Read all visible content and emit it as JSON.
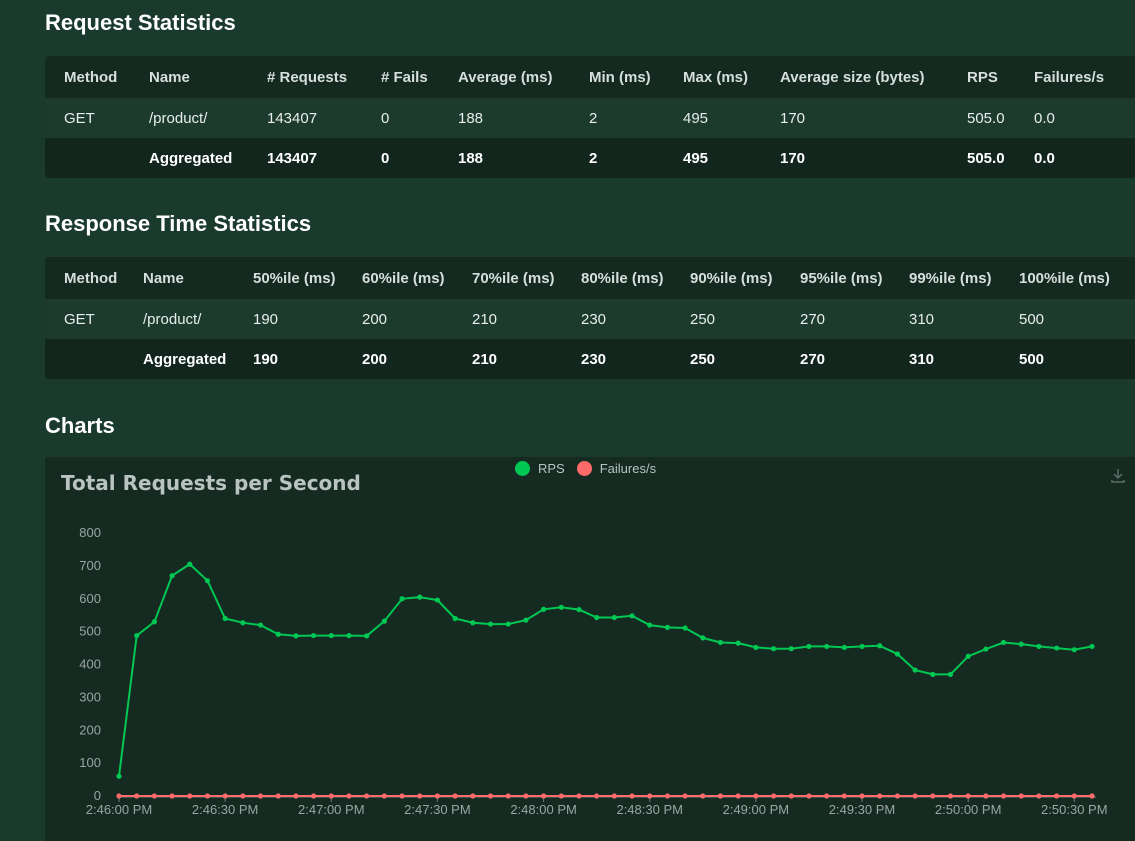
{
  "request_stats": {
    "title": "Request Statistics",
    "headers": [
      "Method",
      "Name",
      "# Requests",
      "# Fails",
      "Average (ms)",
      "Min (ms)",
      "Max (ms)",
      "Average size (bytes)",
      "RPS",
      "Failures/s"
    ],
    "rows": [
      [
        "GET",
        "/product/",
        "143407",
        "0",
        "188",
        "2",
        "495",
        "170",
        "505.0",
        "0.0"
      ]
    ],
    "aggregated": [
      "",
      "Aggregated",
      "143407",
      "0",
      "188",
      "2",
      "495",
      "170",
      "505.0",
      "0.0"
    ]
  },
  "response_stats": {
    "title": "Response Time Statistics",
    "headers": [
      "Method",
      "Name",
      "50%ile (ms)",
      "60%ile (ms)",
      "70%ile (ms)",
      "80%ile (ms)",
      "90%ile (ms)",
      "95%ile (ms)",
      "99%ile (ms)",
      "100%ile (ms)"
    ],
    "rows": [
      [
        "GET",
        "/product/",
        "190",
        "200",
        "210",
        "230",
        "250",
        "270",
        "310",
        "500"
      ]
    ],
    "aggregated": [
      "",
      "Aggregated",
      "190",
      "200",
      "210",
      "230",
      "250",
      "270",
      "310",
      "500"
    ]
  },
  "charts": {
    "title": "Charts",
    "download_icon": "download-icon"
  },
  "chart_data": {
    "type": "line",
    "title": "Total Requests per Second",
    "xlabel": "",
    "ylabel": "",
    "ylim": [
      0,
      800
    ],
    "yticks": [
      0,
      100,
      200,
      300,
      400,
      500,
      600,
      700,
      800
    ],
    "xtick_labels": [
      "2:46:00 PM",
      "2:46:30 PM",
      "2:47:00 PM",
      "2:47:30 PM",
      "2:48:00 PM",
      "2:48:30 PM",
      "2:49:00 PM",
      "2:49:30 PM",
      "2:50:00 PM",
      "2:50:30 PM"
    ],
    "x_start": "2:46:00 PM",
    "x_interval_seconds": 5,
    "legend_position": "top-center",
    "grid": false,
    "series": [
      {
        "name": "RPS",
        "color": "#00c853",
        "values": [
          60,
          488,
          530,
          670,
          705,
          655,
          540,
          527,
          520,
          492,
          487,
          488,
          488,
          488,
          487,
          532,
          600,
          605,
          596,
          540,
          527,
          523,
          523,
          535,
          568,
          574,
          567,
          543,
          543,
          548,
          520,
          513,
          511,
          481,
          467,
          465,
          452,
          448,
          448,
          455,
          455,
          452,
          455,
          457,
          432,
          383,
          370,
          370,
          425,
          447,
          467,
          462,
          455,
          450,
          445,
          455
        ]
      },
      {
        "name": "Failures/s",
        "color": "#ff6b6b",
        "values": [
          0,
          0,
          0,
          0,
          0,
          0,
          0,
          0,
          0,
          0,
          0,
          0,
          0,
          0,
          0,
          0,
          0,
          0,
          0,
          0,
          0,
          0,
          0,
          0,
          0,
          0,
          0,
          0,
          0,
          0,
          0,
          0,
          0,
          0,
          0,
          0,
          0,
          0,
          0,
          0,
          0,
          0,
          0,
          0,
          0,
          0,
          0,
          0,
          0,
          0,
          0,
          0,
          0,
          0,
          0,
          0
        ]
      }
    ]
  }
}
